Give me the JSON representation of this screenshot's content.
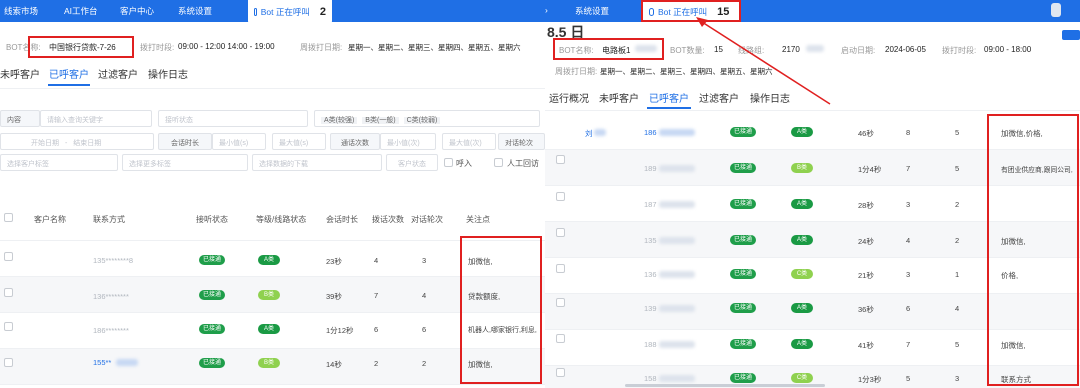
{
  "left": {
    "nav": [
      "线索市场",
      "AI工作台",
      "客户中心",
      "系统设置"
    ],
    "call": {
      "label": "Bot 正在呼叫",
      "count": "2"
    },
    "info": {
      "bot_label": "BOT名称:",
      "bot_value": "中国银行贷款-7-26",
      "time_label": "拨打时段:",
      "time_value": "09:00 - 12:00 14:00 - 19:00",
      "date_label": "周拨打日期:",
      "date_value": "星期一、星期二、星期三、星期四、星期五、星期六"
    },
    "tabs": [
      "未呼客户",
      "已呼客户",
      "过滤客户",
      "操作日志"
    ],
    "filters": {
      "content_label": "内容",
      "content_ph": "请输入查询关键字",
      "status_ph": "接听状态",
      "grade_a": "A类(较强)",
      "grade_b": "B类(一般)",
      "grade_c": "C类(较弱)",
      "start_ph": "开始日期",
      "end_ph": "结束日期",
      "duration_label": "会话时长",
      "min_ph": "最小值(s)",
      "max_ph": "最大值(s)",
      "rounds_label": "通话次数",
      "min2_ph": "最小值(次)",
      "max2_ph": "最大值(次)",
      "dialog_label": "对话轮次",
      "tag_ph": "选择客户标签",
      "tag2_ph": "选择更多标签",
      "data_ph": "选择数据的下载",
      "status2_ph": "客户状态",
      "r1": "呼入",
      "r2": "人工回访"
    },
    "columns": [
      "客户名称",
      "联系方式",
      "接听状态",
      "等级/线路状态",
      "会话时长",
      "拨话次数",
      "对话轮次",
      "关注点"
    ],
    "rows": [
      {
        "phone": "135********8",
        "status": "已接通",
        "grade": "A类",
        "duration": "23秒",
        "calls": "4",
        "rounds": "3",
        "focus": "加微信,"
      },
      {
        "phone": "136********",
        "status": "已接通",
        "grade": "B类",
        "duration": "39秒",
        "calls": "7",
        "rounds": "4",
        "focus": "贷款额度,"
      },
      {
        "phone": "186********",
        "status": "已接通",
        "grade": "A类",
        "duration": "1分12秒",
        "calls": "6",
        "rounds": "6",
        "focus": "机器人,哪家银行,利息,"
      },
      {
        "phone": "155**",
        "status": "已接通",
        "grade": "B类",
        "duration": "14秒",
        "calls": "2",
        "rounds": "2",
        "focus": "加微信,"
      }
    ]
  },
  "right": {
    "nav": [
      "系统设置"
    ],
    "call": {
      "label": "Bot 正在呼叫",
      "count": "15"
    },
    "heading": "8.5 日",
    "info": {
      "bot_label": "BOT名称:",
      "bot_value": "电路板1",
      "count_label": "BOT数量:",
      "count_value": "15",
      "task_label": "线路组:",
      "task_value": "2170",
      "start_label": "启动日期:",
      "start_value": "2024-06-05",
      "time_label": "拨打时段:",
      "time_value": "09:00 - 18:00",
      "date_label": "周拨打日期:",
      "date_value": "星期一、星期二、星期三、星期四、星期五、星期六"
    },
    "tabs": [
      "运行概况",
      "未呼客户",
      "已呼客户",
      "过滤客户",
      "操作日志"
    ],
    "rows": [
      {
        "name": "刘",
        "phone": "186",
        "status": "已接通",
        "grade": "A类",
        "duration": "46秒",
        "calls": "8",
        "rounds": "5",
        "focus": "加微信,价格,"
      },
      {
        "name": "",
        "phone": "189",
        "status": "已接通",
        "grade": "B类",
        "duration": "1分4秒",
        "calls": "7",
        "rounds": "5",
        "focus": "有团业供应商,跟同公司,"
      },
      {
        "name": "",
        "phone": "187",
        "status": "已接通",
        "grade": "A类",
        "duration": "28秒",
        "calls": "3",
        "rounds": "2",
        "focus": ""
      },
      {
        "name": "",
        "phone": "135",
        "status": "已接通",
        "grade": "A类",
        "duration": "24秒",
        "calls": "4",
        "rounds": "2",
        "focus": "加微信,"
      },
      {
        "name": "",
        "phone": "136",
        "status": "已接通",
        "grade": "C类",
        "duration": "21秒",
        "calls": "3",
        "rounds": "1",
        "focus": "价格,"
      },
      {
        "name": "",
        "phone": "139",
        "status": "已接通",
        "grade": "A类",
        "duration": "36秒",
        "calls": "6",
        "rounds": "4",
        "focus": ""
      },
      {
        "name": "",
        "phone": "188",
        "status": "已接通",
        "grade": "A类",
        "duration": "41秒",
        "calls": "7",
        "rounds": "5",
        "focus": "加微信,"
      },
      {
        "name": "",
        "phone": "158",
        "status": "已接通",
        "grade": "C类",
        "duration": "1分3秒",
        "calls": "5",
        "rounds": "3",
        "focus": "联系方式"
      }
    ]
  },
  "colors": {
    "primary": "#1f6fe5",
    "highlight": "#e02020",
    "ok": "#1f9e4a",
    "grade_b": "#8fd14f"
  }
}
